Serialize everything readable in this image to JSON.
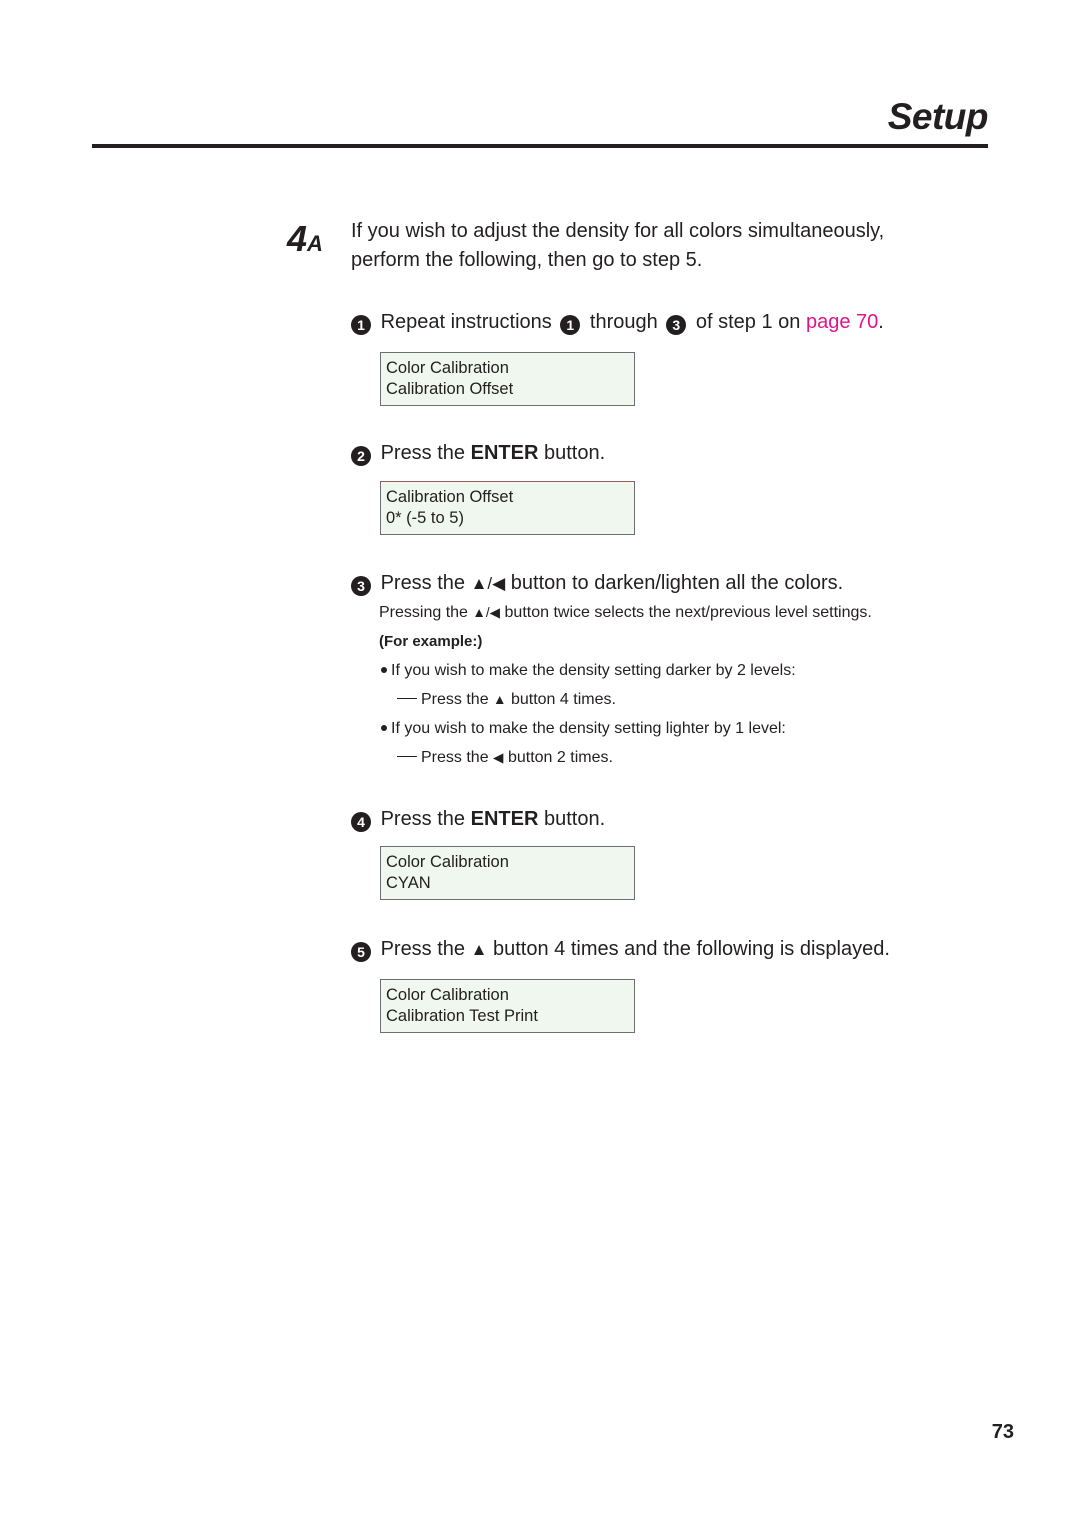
{
  "header": {
    "title": "Setup"
  },
  "step": {
    "number": "4",
    "suffix": "A",
    "intro_line1": "If you wish to adjust the density for all colors simultaneously,",
    "intro_line2": "perform the following, then go to step 5."
  },
  "instructions": [
    {
      "marker": "1",
      "text_a": "Repeat instructions",
      "ref1": "1",
      "text_b": "through",
      "ref2": "3",
      "text_c": "of step 1 on",
      "link": "page 70",
      "text_d": ".",
      "display": {
        "line1": "Color Calibration",
        "line2": "Calibration Offset"
      }
    },
    {
      "marker": "2",
      "text_a": "Press the",
      "bold": "ENTER",
      "text_b": "button.",
      "display": {
        "line1": "Calibration Offset",
        "line2": "0* (-5 to 5)"
      }
    },
    {
      "marker": "3",
      "text_a": "Press the",
      "icons": "▲/◀",
      "text_b": "button to darken/lighten all the colors.",
      "note_a": "Pressing the",
      "note_icons": "▲/◀",
      "note_b": "button twice selects the next/previous level settings.",
      "example_label": "(For example:)",
      "examples": [
        {
          "bullet": "If you wish to make the density setting darker by 2 levels:",
          "action_a": "Press the",
          "icon": "▲",
          "action_b": "button 4 times."
        },
        {
          "bullet": "If you wish to make the density setting lighter by 1 level:",
          "action_a": "Press the",
          "icon": "◀",
          "action_b": "button 2 times."
        }
      ]
    },
    {
      "marker": "4",
      "text_a": "Press the",
      "bold": "ENTER",
      "text_b": "button.",
      "display": {
        "line1": "Color Calibration",
        "line2": "CYAN"
      }
    },
    {
      "marker": "5",
      "text_a": "Press the",
      "icon": "▲",
      "text_b": "button 4 times and the following is displayed.",
      "display": {
        "line1": "Color Calibration",
        "line2": "Calibration Test Print"
      }
    }
  ],
  "footer": {
    "page_number": "73"
  },
  "colors": {
    "link": "#e0148c",
    "lcd_background": "#eff7ee",
    "text": "#231f20"
  }
}
